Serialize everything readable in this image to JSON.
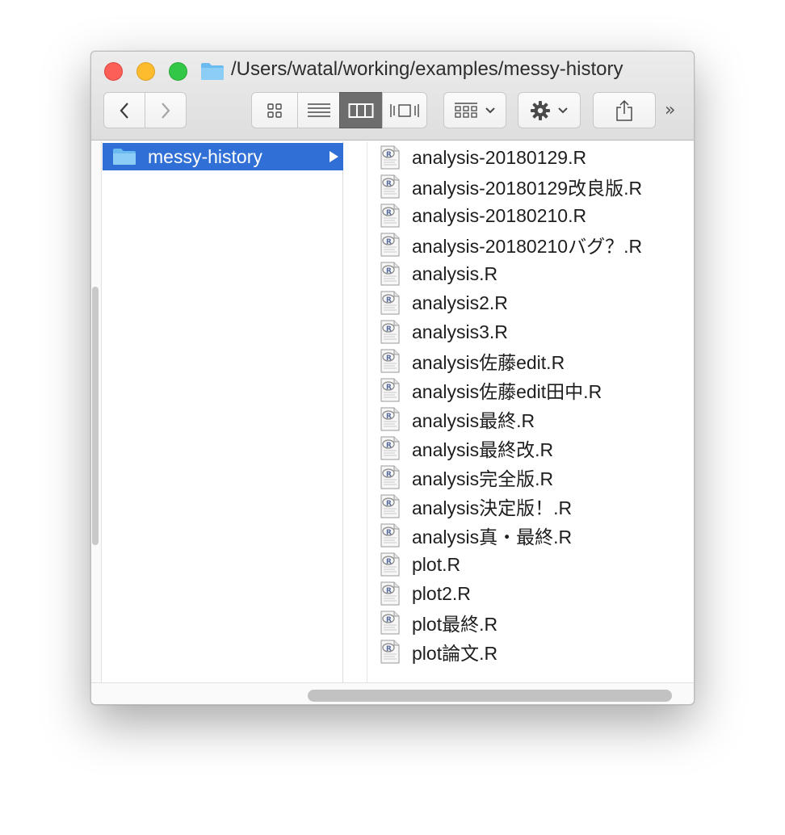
{
  "window": {
    "title": "/Users/watal/working/examples/messy-history"
  },
  "toolbar": {
    "overflow_glyph": "»"
  },
  "sidebar": {
    "selected_folder": "messy-history"
  },
  "files": [
    "analysis-20180129.R",
    "analysis-20180129改良版.R",
    "analysis-20180210.R",
    "analysis-20180210バグ？.R",
    "analysis.R",
    "analysis2.R",
    "analysis3.R",
    "analysis佐藤edit.R",
    "analysis佐藤edit田中.R",
    "analysis最終.R",
    "analysis最終改.R",
    "analysis完全版.R",
    "analysis決定版！.R",
    "analysis真・最終.R",
    "plot.R",
    "plot2.R",
    "plot最終.R",
    "plot論文.R"
  ],
  "colors": {
    "selection": "#2f6fd6",
    "folder": "#6cbbf0"
  }
}
